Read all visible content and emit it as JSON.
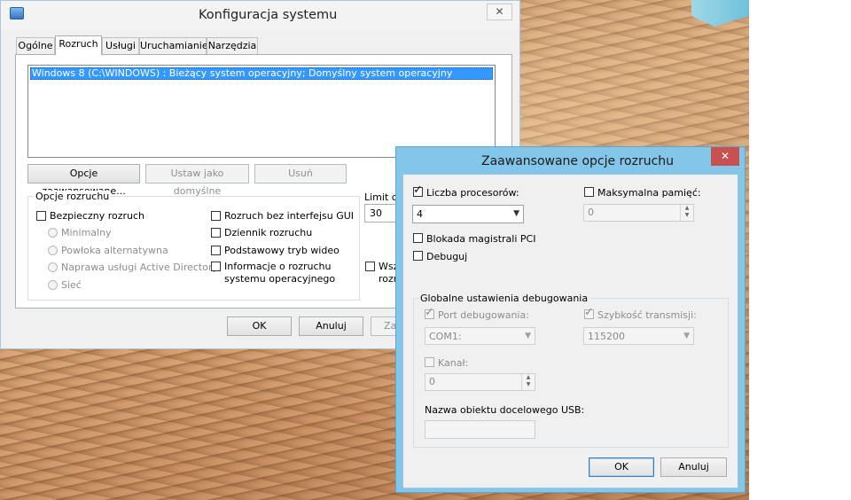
{
  "msconfig": {
    "title": "Konfiguracja systemu",
    "tabs": [
      {
        "label": "Ogólne"
      },
      {
        "label": "Rozruch"
      },
      {
        "label": "Usługi"
      },
      {
        "label": "Uruchamianie"
      },
      {
        "label": "Narzędzia"
      }
    ],
    "os_entry": "Windows 8 (C:\\WINDOWS) : Bieżący system operacyjny; Domyślny system operacyjny",
    "buttons": {
      "advanced": "Opcje zaawansowane...",
      "set_default": "Ustaw jako domyślne",
      "delete": "Usuń",
      "ok": "OK",
      "cancel": "Anuluj",
      "apply": "Zas"
    },
    "boot_options": {
      "title": "Opcje rozruchu",
      "safe_boot": "Bezpieczny rozruch",
      "minimal": "Minimalny",
      "alternate_shell": "Powłoka alternatywna",
      "ad_repair": "Naprawa usługi Active Directory",
      "network": "Sieć",
      "no_gui": "Rozruch bez interfejsu GUI",
      "boot_log": "Dziennik rozruchu",
      "base_video": "Podstawowy tryb wideo",
      "os_boot_info_line1": "Informacje o rozruchu",
      "os_boot_info_line2": "systemu operacyjnego"
    },
    "timeout": {
      "label": "Limit cz",
      "value": "30"
    },
    "make_permanent": {
      "line1": "Wsz",
      "line2": "rozr"
    }
  },
  "advanced": {
    "title": "Zaawansowane opcje rozruchu",
    "close_glyph": "✕",
    "num_processors": {
      "label": "Liczba procesorów:",
      "checked": true,
      "value": "4"
    },
    "max_memory": {
      "label": "Maksymalna pamięć:",
      "checked": false,
      "value": "0"
    },
    "pci_lock": {
      "label": "Blokada magistrali PCI",
      "checked": false
    },
    "debug": {
      "label": "Debuguj",
      "checked": false
    },
    "global_debug": {
      "title": "Globalne ustawienia debugowania",
      "debug_port": {
        "label": "Port debugowania:",
        "value": "COM1:"
      },
      "baud_rate": {
        "label": "Szybkość transmisji:",
        "value": "115200"
      },
      "channel": {
        "label": "Kanał:",
        "value": "0"
      },
      "usb_target": {
        "label": "Nazwa obiektu docelowego USB:",
        "value": ""
      }
    },
    "ok": "OK",
    "cancel": "Anuluj"
  },
  "colors": {
    "selection": "#3399ff",
    "close_red": "#c75050",
    "dialog_frame": "#84c6e9"
  }
}
